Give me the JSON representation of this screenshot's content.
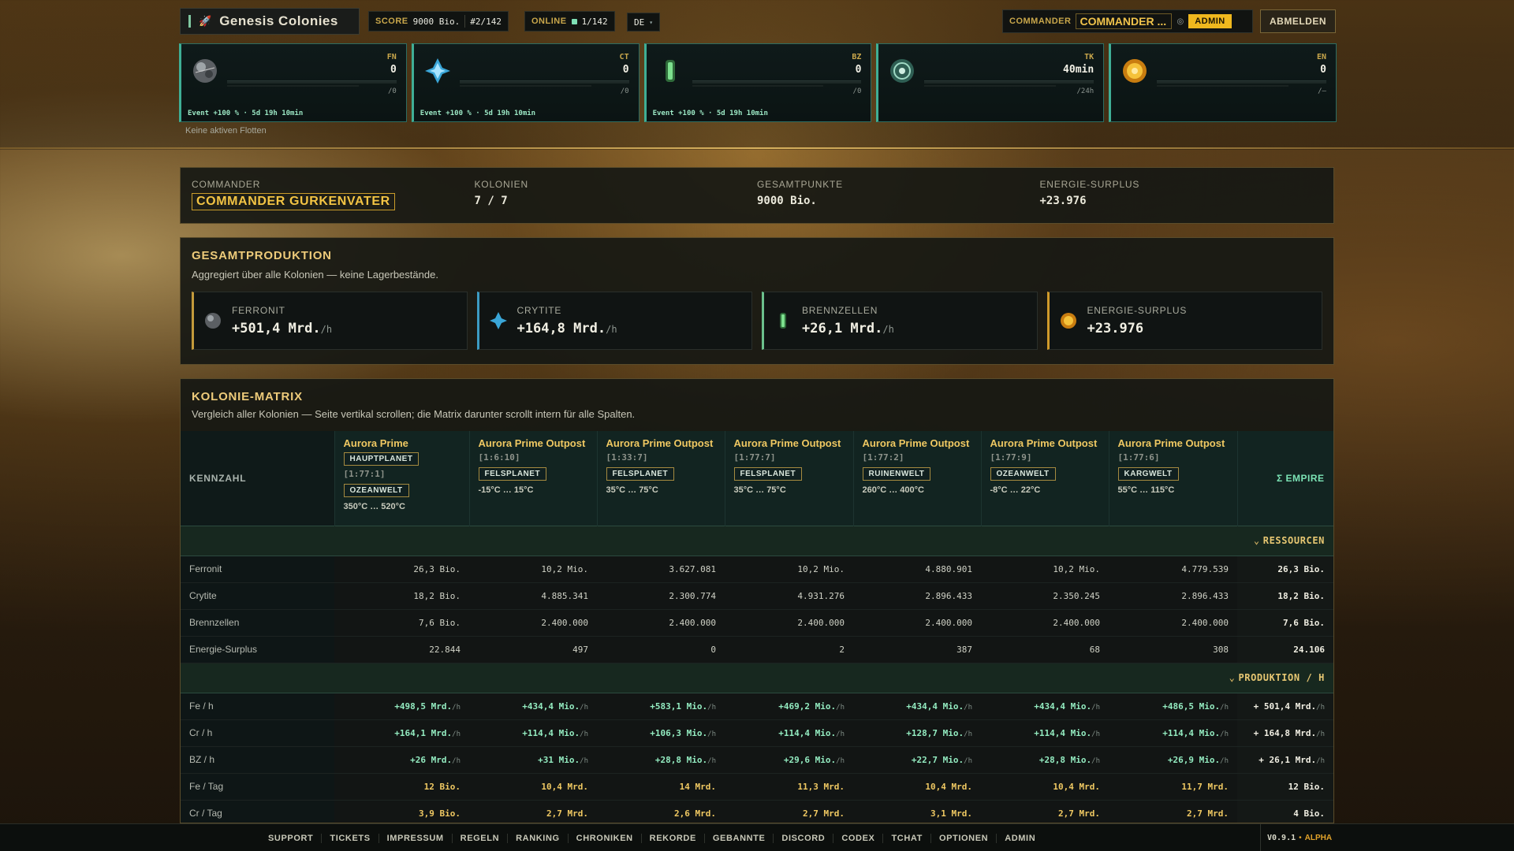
{
  "app": {
    "title": "Genesis Colonies"
  },
  "header": {
    "score_label": "SCORE",
    "score_value": "9000 Bio.",
    "rank": "#2/142",
    "online_label": "ONLINE",
    "online_value": "1/142",
    "lang": "DE",
    "commander_label": "COMMANDER",
    "commander_value": "COMMANDER ...",
    "admin_badge": "ADMIN",
    "logout": "ABMELDEN"
  },
  "resources": [
    {
      "code": "FN",
      "value": "0",
      "cap": "/0",
      "event": "Event +100 % · 5d 19h 10min",
      "icon": "ferronit-icon"
    },
    {
      "code": "CT",
      "value": "0",
      "cap": "/0",
      "event": "Event +100 % · 5d 19h 10min",
      "icon": "crytite-icon"
    },
    {
      "code": "BZ",
      "value": "0",
      "cap": "/0",
      "event": "Event +100 % · 5d 19h 10min",
      "icon": "brennzellen-icon"
    },
    {
      "code": "TK",
      "value": "40min",
      "cap": "/24h",
      "event": "",
      "icon": "tk-icon"
    },
    {
      "code": "EN",
      "value": "0",
      "cap": "/—",
      "event": "",
      "icon": "energy-icon"
    }
  ],
  "fleets_text": "Keine aktiven Flotten",
  "summary": {
    "commander_label": "COMMANDER",
    "commander_name": "COMMANDER GURKENVATER",
    "colonies_label": "KOLONIEN",
    "colonies_value": "7 / 7",
    "points_label": "GESAMTPUNKTE",
    "points_value": "9000 Bio.",
    "energy_label": "ENERGIE-SURPLUS",
    "energy_value": "+23.976"
  },
  "production": {
    "title": "GESAMTPRODUKTION",
    "subtitle": "Aggregiert über alle Kolonien — keine Lagerbestände.",
    "cards": [
      {
        "label": "FERRONIT",
        "value": "+501,4 Mrd.",
        "unit": "/h"
      },
      {
        "label": "CRYTITE",
        "value": "+164,8 Mrd.",
        "unit": "/h"
      },
      {
        "label": "BRENNZELLEN",
        "value": "+26,1 Mrd.",
        "unit": "/h"
      },
      {
        "label": "ENERGIE-SURPLUS",
        "value": "+23.976",
        "unit": ""
      }
    ]
  },
  "matrix": {
    "title": "KOLONIE-MATRIX",
    "subtitle": "Vergleich aller Kolonien — Seite vertikal scrollen; die Matrix darunter scrollt intern für alle Spalten.",
    "key_header": "KENNZAHL",
    "sum_header": "Σ EMPIRE",
    "colonies": [
      {
        "name": "Aurora Prime",
        "main": "HAUPTPLANET",
        "coord": "[1:77:1]",
        "type": "OZEANWELT",
        "temp": "350°C … 520°C"
      },
      {
        "name": "Aurora Prime Outpost",
        "coord": "[1:6:10]",
        "type": "FELSPLANET",
        "temp": "-15°C … 15°C"
      },
      {
        "name": "Aurora Prime Outpost",
        "coord": "[1:33:7]",
        "type": "FELSPLANET",
        "temp": "35°C … 75°C"
      },
      {
        "name": "Aurora Prime Outpost",
        "coord": "[1:77:7]",
        "type": "FELSPLANET",
        "temp": "35°C … 75°C"
      },
      {
        "name": "Aurora Prime Outpost",
        "coord": "[1:77:2]",
        "type": "RUINENWELT",
        "temp": "260°C … 400°C"
      },
      {
        "name": "Aurora Prime Outpost",
        "coord": "[1:77:9]",
        "type": "OZEANWELT",
        "temp": "-8°C … 22°C"
      },
      {
        "name": "Aurora Prime Outpost",
        "coord": "[1:77:6]",
        "type": "KARGWELT",
        "temp": "55°C … 115°C"
      }
    ],
    "sections": [
      {
        "title": "RESSOURCEN",
        "kind": "res",
        "rows": [
          {
            "label": "Ferronit",
            "values": [
              "26,3 Bio.",
              "10,2 Mio.",
              "3.627.081",
              "10,2 Mio.",
              "4.880.901",
              "10,2 Mio.",
              "4.779.539"
            ],
            "total": "26,3 Bio."
          },
          {
            "label": "Crytite",
            "values": [
              "18,2 Bio.",
              "4.885.341",
              "2.300.774",
              "4.931.276",
              "2.896.433",
              "2.350.245",
              "2.896.433"
            ],
            "total": "18,2 Bio."
          },
          {
            "label": "Brennzellen",
            "values": [
              "7,6 Bio.",
              "2.400.000",
              "2.400.000",
              "2.400.000",
              "2.400.000",
              "2.400.000",
              "2.400.000"
            ],
            "total": "7,6 Bio."
          },
          {
            "label": "Energie-Surplus",
            "values": [
              "22.844",
              "497",
              "0",
              "2",
              "387",
              "68",
              "308"
            ],
            "total": "24.106"
          }
        ]
      },
      {
        "title": "PRODUKTION / H",
        "kind": "prod",
        "rows": [
          {
            "label": "Fe / h",
            "values": [
              "+498,5 Mrd.",
              "+434,4 Mio.",
              "+583,1 Mio.",
              "+469,2 Mio.",
              "+434,4 Mio.",
              "+434,4 Mio.",
              "+486,5 Mio."
            ],
            "total": "+ 501,4 Mrd.",
            "unit": "/h"
          },
          {
            "label": "Cr / h",
            "values": [
              "+164,1 Mrd.",
              "+114,4 Mio.",
              "+106,3 Mio.",
              "+114,4 Mio.",
              "+128,7 Mio.",
              "+114,4 Mio.",
              "+114,4 Mio."
            ],
            "total": "+ 164,8 Mrd.",
            "unit": "/h"
          },
          {
            "label": "BZ / h",
            "values": [
              "+26 Mrd.",
              "+31 Mio.",
              "+28,8 Mio.",
              "+29,6 Mio.",
              "+22,7 Mio.",
              "+28,8 Mio.",
              "+26,9 Mio."
            ],
            "total": "+ 26,1 Mrd.",
            "unit": "/h"
          },
          {
            "label": "Fe / Tag",
            "values": [
              "12 Bio.",
              "10,4 Mrd.",
              "14 Mrd.",
              "11,3 Mrd.",
              "10,4 Mrd.",
              "10,4 Mrd.",
              "11,7 Mrd."
            ],
            "total": "12 Bio.",
            "day": true
          },
          {
            "label": "Cr / Tag",
            "values": [
              "3,9 Bio.",
              "2,7 Mrd.",
              "2,6 Mrd.",
              "2,7 Mrd.",
              "3,1 Mrd.",
              "2,7 Mrd.",
              "2,7 Mrd."
            ],
            "total": "4 Bio.",
            "day": true
          }
        ]
      }
    ]
  },
  "footer": {
    "links": [
      "SUPPORT",
      "TICKETS",
      "IMPRESSUM",
      "REGELN",
      "RANKING",
      "CHRONIKEN",
      "REKORDE",
      "GEBANNTE",
      "DISCORD",
      "CODEX",
      "TCHAT",
      "OPTIONEN",
      "ADMIN"
    ],
    "version": "V0.9.1",
    "stage": "ALPHA"
  }
}
